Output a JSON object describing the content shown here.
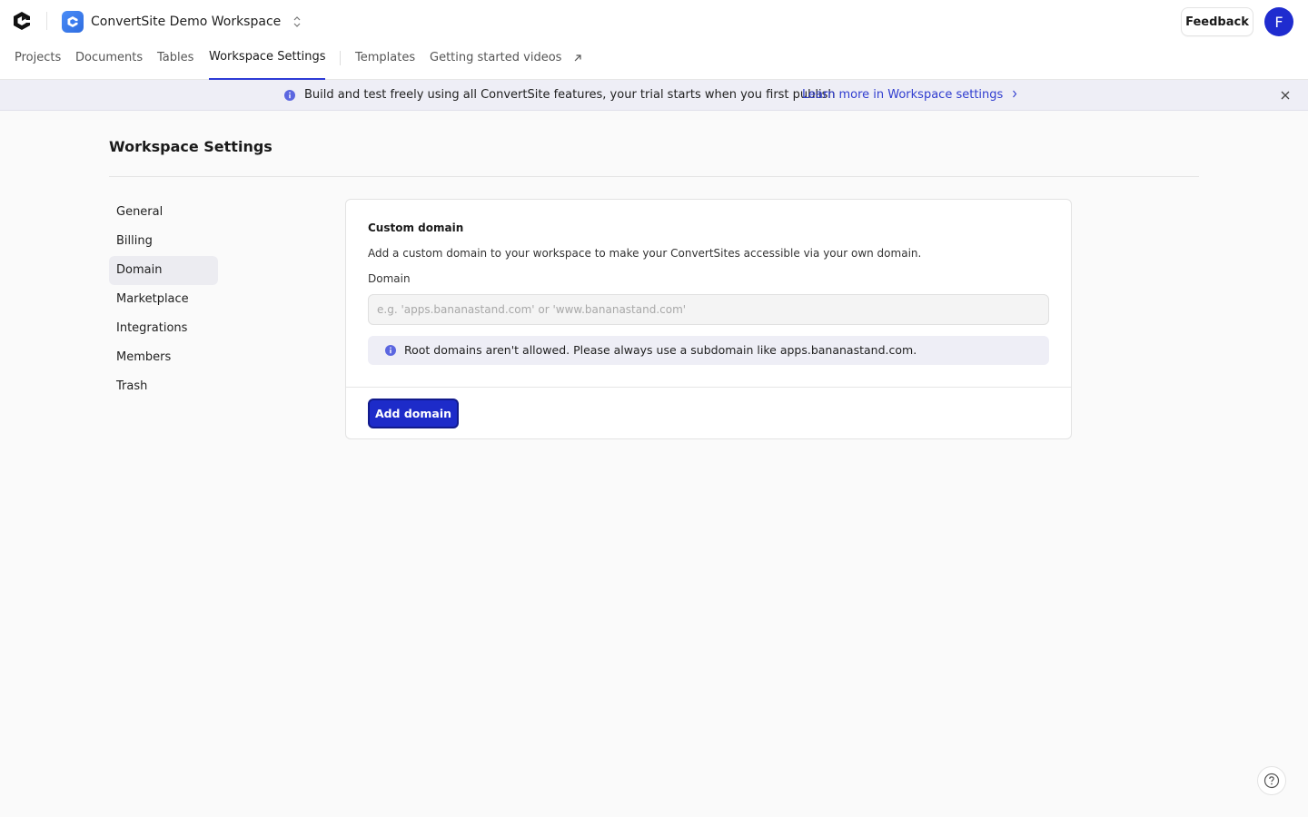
{
  "header": {
    "workspace_name": "ConvertSite Demo Workspace",
    "feedback_label": "Feedback",
    "avatar_initial": "F"
  },
  "nav": {
    "items": [
      {
        "label": "Projects"
      },
      {
        "label": "Documents"
      },
      {
        "label": "Tables"
      },
      {
        "label": "Workspace Settings",
        "active": true
      },
      {
        "label": "Templates"
      },
      {
        "label": "Getting started videos"
      }
    ]
  },
  "banner": {
    "text": "Build and test freely using all ConvertSite features, your trial starts when you first publish",
    "link_label": "Learn more in Workspace settings"
  },
  "page": {
    "title": "Workspace Settings"
  },
  "sidebar": {
    "items": [
      {
        "label": "General"
      },
      {
        "label": "Billing"
      },
      {
        "label": "Domain",
        "active": true
      },
      {
        "label": "Marketplace"
      },
      {
        "label": "Integrations"
      },
      {
        "label": "Members"
      },
      {
        "label": "Trash"
      }
    ]
  },
  "domain_card": {
    "title": "Custom domain",
    "description": "Add a custom domain to your workspace to make your ConvertSites accessible via your own domain.",
    "field_label": "Domain",
    "input_value": "",
    "input_placeholder": "e.g. 'apps.bananastand.com' or 'www.bananastand.com'",
    "alert_text": "Root domains aren't allowed. Please always use a subdomain like apps.bananastand.com.",
    "add_button_label": "Add domain"
  },
  "colors": {
    "accent": "#1d2bc9",
    "link": "#2f3ccf",
    "banner_bg": "#eeeef6",
    "avatar_bg": "#1f2ccf"
  },
  "icons": {
    "logo": "app-logo-icon",
    "workspace": "workspace-icon",
    "switcher": "chevron-up-down-icon",
    "external": "arrow-up-right-icon",
    "info": "info-icon",
    "chevron": "chevron-right-icon",
    "close": "close-icon",
    "help": "question-mark-icon"
  }
}
